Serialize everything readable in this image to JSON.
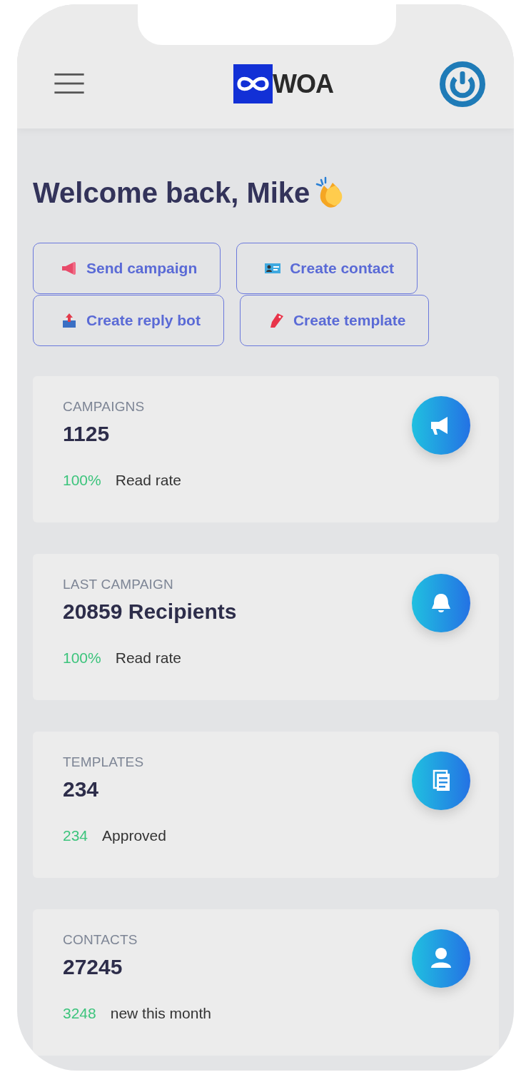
{
  "header": {
    "brand": "WOA"
  },
  "greeting": "Welcome back, Mike",
  "actions": [
    {
      "label": "Send campaign"
    },
    {
      "label": "Create contact"
    },
    {
      "label": "Create reply bot"
    },
    {
      "label": "Create template"
    }
  ],
  "stats": [
    {
      "title": "CAMPAIGNS",
      "value": "1125",
      "highlight": "100%",
      "note": "Read rate"
    },
    {
      "title": "LAST CAMPAIGN",
      "value": "20859 Recipients",
      "highlight": "100%",
      "note": "Read rate"
    },
    {
      "title": "TEMPLATES",
      "value": "234",
      "highlight": "234",
      "note": "Approved"
    },
    {
      "title": "CONTACTS",
      "value": "27245",
      "highlight": "3248",
      "note": "new this month"
    }
  ]
}
